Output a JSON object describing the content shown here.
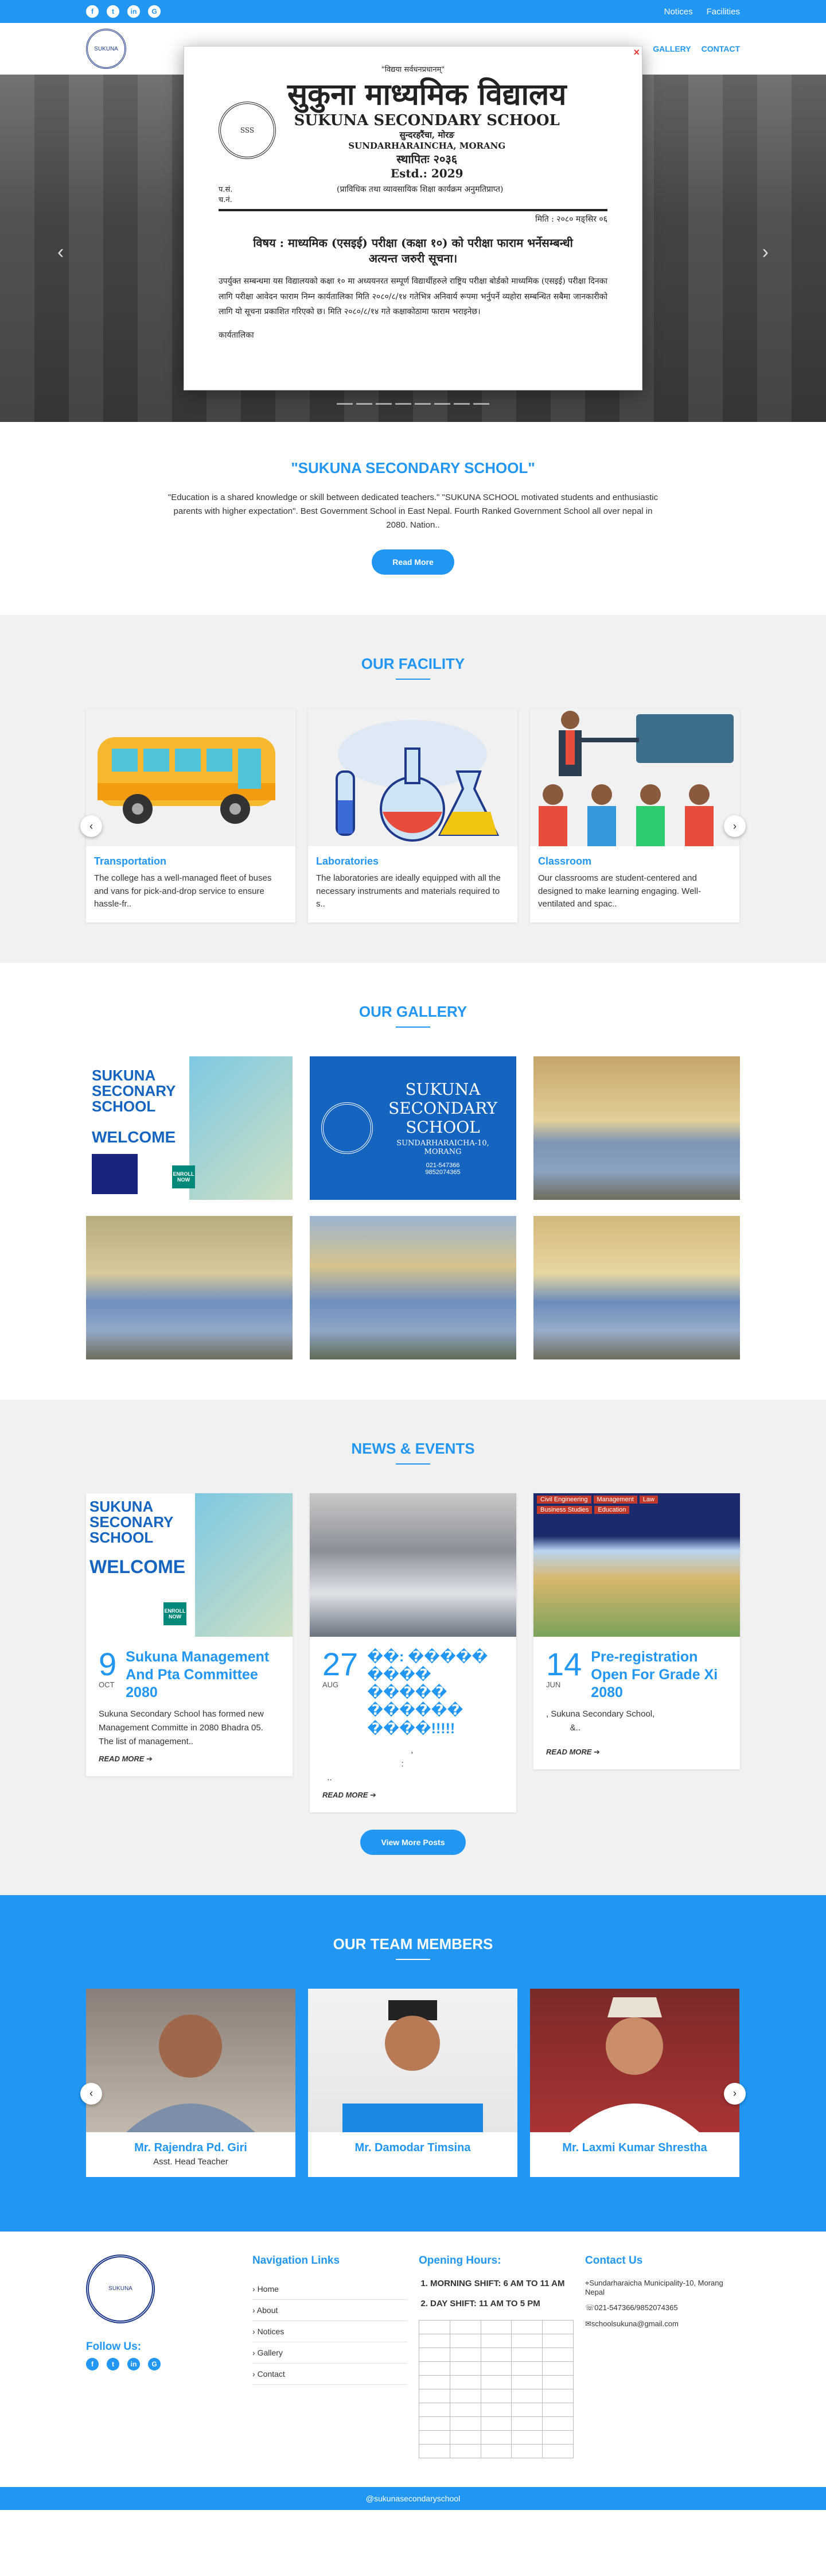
{
  "topbar": {
    "social": [
      "f",
      "t",
      "in",
      "G"
    ],
    "links": [
      "Notices",
      "Facilities"
    ]
  },
  "header": {
    "logo_text": "SUKUNA",
    "nav": [
      "Gallery",
      "Contact"
    ]
  },
  "hero": {
    "prev": "‹",
    "next": "›"
  },
  "notice": {
    "tagline": "\"विद्यया सर्वधनप्रधानम्\"",
    "logo_text": "SSS",
    "school_np": "सुकुना माध्यमिक विद्यालय",
    "school_en": "SUKUNA SECONDARY SCHOOL",
    "place_np": "सुन्दरहरैंचा, मोरङ",
    "place_en": "SUNDARHARAINCHA, MORANG",
    "estd_np": "स्थापितः २०३६",
    "estd_en": "Estd.: 2029",
    "ref_pa": "प.सं.",
    "ref_cha": "च.नं.",
    "program": "(प्राविधिक तथा व्यावसायिक शिक्षा कार्यक्रम अनुमतिप्राप्त)",
    "date": "मिति : २०८० मङ्सिर ०६",
    "subject": "विषय : माध्यमिक (एसइई) परीक्षा (कक्षा १०) को परीक्षा फाराम भर्नेसम्बन्धी",
    "attention": "अत्यन्त जरुरी    सूचना।",
    "body": "उपर्युक्त सम्बन्धमा यस विद्यालयको कक्षा १० मा अध्ययनरत सम्पूर्ण विद्यार्थीहरुले राष्ट्रिय परीक्षा बोर्डको माध्यमिक (एसइई) परीक्षा दिनका लागि परीक्षा आवेदन फाराम निम्न कार्यतालिका मिति २०८०/८/१४ गतेभित्र अनिवार्य रूपमा भर्नुपर्ने व्यहोरा सम्बन्धित सबैमा जानकारीको लागि यो सूचना प्रकाशित गरिएको छ। मिति २०८०/८/१४ गते कक्षाकोठामा फाराम भराइनेछ।",
    "footer": "कार्यतालिका"
  },
  "intro": {
    "title": "\"SUKUNA SECONDARY SCHOOL\"",
    "text": "\"Education is a shared knowledge or skill between dedicated teachers.\" \"SUKUNA SCHOOL motivated students and enthusiastic parents with higher expectation\". Best Government School in East Nepal. Fourth Ranked Government School all over nepal in 2080. Nation..",
    "button": "Read More"
  },
  "facility": {
    "title": "OUR FACILITY",
    "cards": [
      {
        "title": "Transportation",
        "text": "The college has a well-managed fleet of buses and vans for pick-and-drop service to ensure hassle-fr.."
      },
      {
        "title": "Laboratories",
        "text": "The laboratories are ideally equipped with all the necessary instruments and materials required to s.."
      },
      {
        "title": "Classroom",
        "text": "Our classrooms are student-centered and designed to make learning engaging. Well-ventilated and spac.."
      }
    ]
  },
  "gallery": {
    "title": "OUR GALLERY",
    "poster1": {
      "l1": "SUKUNA",
      "l2": "SECONARY",
      "l3": "SCHOOL",
      "welcome": "WELCOME",
      "enroll": "ENROLL NOW"
    },
    "poster2": {
      "l1": "SUKUNA SECONDARY",
      "l2": "SCHOOL",
      "l3": "SUNDARHARAICHA-10, MORANG",
      "phone1": "021-547366",
      "phone2": "9852074365"
    }
  },
  "news": {
    "title": "NEWS & EVENTS",
    "items": [
      {
        "day": "9",
        "month": "Oct",
        "title": "Sukuna Management And Pta Committee 2080",
        "excerpt": "Sukuna Secondary School has formed new Management Committe in 2080 Bhadra 05. The list of management..",
        "more": "READ MORE ➔"
      },
      {
        "day": "27",
        "month": "Aug",
        "title": "��: ����� ���� ����� ������ ����!!!!!",
        "excerpt": "                                     ,\n                                 :\n  ..",
        "more": "READ MORE ➔"
      },
      {
        "day": "14",
        "month": "Jun",
        "title": "Pre-registration Open For Grade Xi 2080",
        "excerpt": ", Sukuna Secondary School,\n          &..",
        "more": "READ MORE ➔"
      }
    ],
    "button": "View More Posts",
    "poster3_tags": [
      "Civil Engineering",
      "Management",
      "Law",
      "Business Studies",
      "Education"
    ]
  },
  "team": {
    "title": "OUR TEAM MEMBERS",
    "members": [
      {
        "name": "Mr. Rajendra Pd. Giri",
        "role": "Asst. Head Teacher"
      },
      {
        "name": "Mr. Damodar Timsina",
        "role": ""
      },
      {
        "name": "Mr. Laxmi Kumar Shrestha",
        "role": ""
      }
    ]
  },
  "footer": {
    "follow": "Follow Us:",
    "nav_title": "Navigation Links",
    "nav": [
      "Home",
      "About",
      "Notices",
      "Gallery",
      "Contact"
    ],
    "hours_title": "Opening Hours:",
    "hours": [
      "MORNING SHIFT: 6 AM TO 11 AM",
      "DAY SHIFT: 11 AM TO 5 PM"
    ],
    "contact_title": "Contact Us",
    "address": "Sundarharaicha Municipality-10, Morang Nepal",
    "phone": "021-547366/9852074365",
    "email": "schoolsukuna@gmail.com",
    "copyright": "@sukunasecondaryschool"
  },
  "colors": {
    "accent": "#2196f3"
  }
}
